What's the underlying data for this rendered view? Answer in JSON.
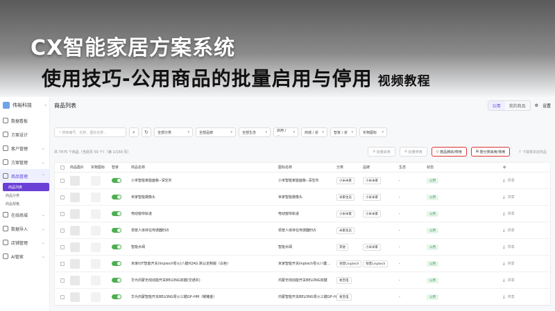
{
  "overlay": {
    "title_line1": "CX智能家居方案系统",
    "title_line2": "使用技巧-公用商品的批量启用与停用",
    "title_suffix": "视频教程"
  },
  "sidebar": {
    "brand": "伟裕科技",
    "items": [
      {
        "label": "数据看板"
      },
      {
        "label": "方案设计"
      },
      {
        "label": "客户管理"
      },
      {
        "label": "方案管理"
      },
      {
        "label": "商品管理"
      },
      {
        "label": "在线商城"
      },
      {
        "label": "数据导入"
      },
      {
        "label": "店铺管理"
      },
      {
        "label": "AI管家"
      }
    ],
    "sub_items": [
      {
        "label": "商品列表"
      },
      {
        "label": "商品分类"
      },
      {
        "label": "商品规格"
      }
    ]
  },
  "header": {
    "title": "商品列表",
    "seg_public": "公用",
    "seg_mine": "我的商品",
    "settings": "设置"
  },
  "filters": {
    "search_placeholder": "搜索编号、名称、图标名称…",
    "category": "全部分类",
    "brand": "全部品牌",
    "ecosystem": "全部生态",
    "f4": "启用 / ...",
    "f5": "商城 / 状",
    "f6": "智家 / 状",
    "f7": "实物图标"
  },
  "actions": {
    "summary": "共 7475 个商品（当前页 50 个）（第 1/150 页）",
    "enable": "批量启用",
    "disable": "批量停用",
    "tag_toggle": "按品牌启/停用",
    "cat_toggle": "按分类启用/停用",
    "download": "下载我本店商品"
  },
  "table": {
    "headers": [
      "商品图片",
      "实物图标",
      "智家",
      "商品名称",
      "图标名称",
      "分类",
      "品牌",
      "生态",
      "状态"
    ],
    "rows": [
      {
        "name": "小米智能家庭面板--深空灰",
        "icon_name": "小米智能家庭面板--深空灰",
        "category": "小米米家",
        "brand": "小米米家",
        "eco": "-",
        "status": "公用",
        "op": "共享"
      },
      {
        "name": "米家智能摄像头",
        "icon_name": "米家智能摄像头",
        "category": "米家生态",
        "brand": "小米米家",
        "eco": "-",
        "status": "公用",
        "op": "共享"
      },
      {
        "name": "电动窗帘轨道",
        "icon_name": "电动窗帘轨道",
        "category": "小米米家",
        "brand": "小米米家",
        "eco": "-",
        "status": "公用",
        "op": "共享"
      },
      {
        "name": "领普人体存在传感器ES5",
        "icon_name": "领普人体存在传感器ES5",
        "category": "米家生态",
        "brand": "",
        "eco": "-",
        "status": "公用",
        "op": "共享"
      },
      {
        "name": "智能水阀",
        "icon_name": "智能水阀",
        "category": "其他",
        "brand": "小米米家",
        "eco": "-",
        "status": "公用",
        "op": "共享"
      },
      {
        "name": "米家IOT智能开关(linptech零火)八键H2AG 默认定制版（白色）",
        "icon_name": "米家智能开关linptech零火八键…",
        "category": "领普Linptech",
        "brand": "领普Linptech",
        "eco": "-",
        "status": "公用",
        "op": "共享"
      },
      {
        "name": "华为鸿蒙无线动能开关BELONG双键(交通灰)",
        "icon_name": "鸿蒙无线动能开关BELONG双键",
        "category": "易百电",
        "brand": "",
        "eco": "-",
        "status": "公用",
        "op": "共享"
      },
      {
        "name": "华为鸿蒙智能开关BELONG零火三键GP–HM（曜曦金）",
        "icon_name": "鸿蒙智能开关BELONG零火三键GP–HM",
        "category": "易百电",
        "brand": "",
        "eco": "-",
        "status": "公用",
        "op": "共享"
      }
    ]
  }
}
